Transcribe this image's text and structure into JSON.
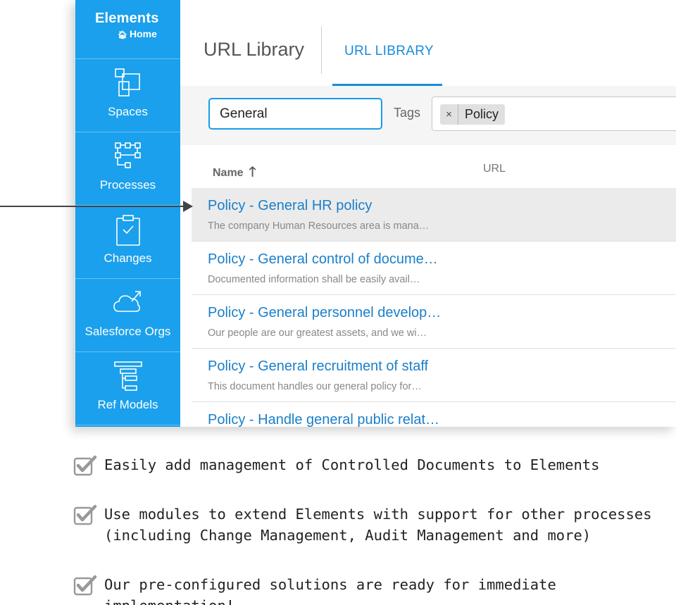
{
  "sidebar": {
    "brand": "Elements",
    "home": "Home",
    "items": [
      {
        "label": "Spaces",
        "icon": "spaces-icon"
      },
      {
        "label": "Processes",
        "icon": "processes-icon"
      },
      {
        "label": "Changes",
        "icon": "changes-icon"
      },
      {
        "label": "Salesforce Orgs",
        "icon": "cloud-icon"
      },
      {
        "label": "Ref Models",
        "icon": "ref-models-icon"
      }
    ]
  },
  "header": {
    "title": "URL Library",
    "tab": "URL LIBRARY"
  },
  "filters": {
    "search_value": "General",
    "tags_label": "Tags",
    "tag_remove": "×",
    "tag": "Policy"
  },
  "table": {
    "columns": {
      "name": "Name",
      "sort_arrow": "🡑",
      "url": "URL"
    },
    "rows": [
      {
        "title": "Policy - General HR policy",
        "desc": "The company Human Resources area is mana…",
        "selected": true
      },
      {
        "title": "Policy - General control of docume…",
        "desc": "Documented information shall be easily avail…",
        "selected": false
      },
      {
        "title": "Policy - General personnel develop…",
        "desc": "Our people are our greatest assets, and we wi…",
        "selected": false
      },
      {
        "title": "Policy - General recruitment of staff",
        "desc": "This document handles our general policy for…",
        "selected": false
      },
      {
        "title": "Policy - Handle general public relat…",
        "desc": "",
        "selected": false
      }
    ]
  },
  "features": [
    {
      "line1": "Easily add management of Controlled Documents to Elements",
      "line2": ""
    },
    {
      "line1": "Use modules to extend Elements with support for other processes",
      "line2": "(including Change Management, Audit Management and more)"
    },
    {
      "line1": "Our pre-configured solutions are ready for immediate implementation!",
      "line2": ""
    }
  ],
  "colors": {
    "sidebar": "#1aa0ec",
    "accent": "#1a8cd8",
    "link": "#1a7fc9",
    "selected_row": "#ebebeb"
  }
}
